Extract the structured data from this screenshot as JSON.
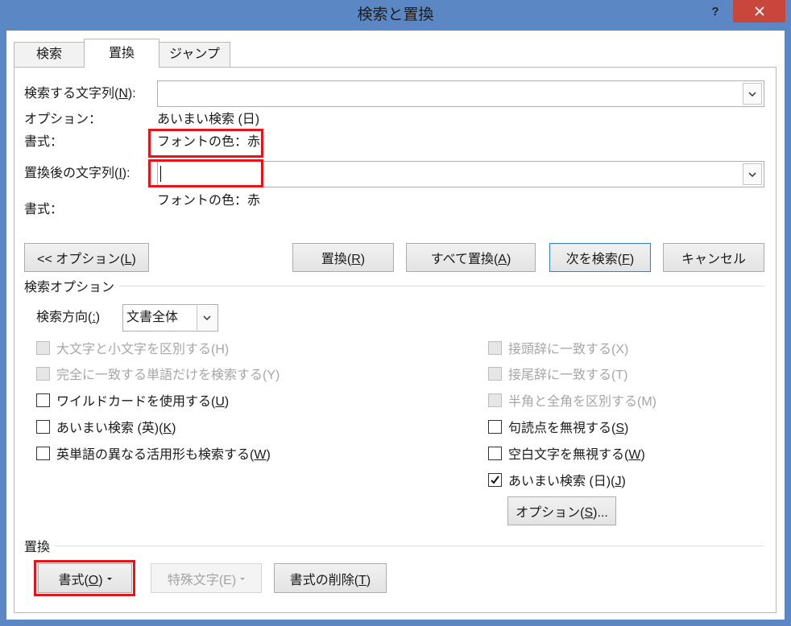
{
  "window": {
    "title": "検索と置換",
    "help_label": "?",
    "close_icon": "close-icon"
  },
  "colors": {
    "titlebar": "#5b88c4",
    "close_button": "#c9463d",
    "highlight": "#e4141b",
    "default_button_border": "#3c7fb1"
  },
  "tabs": [
    {
      "label": "検索",
      "selected": false
    },
    {
      "label": "置換",
      "selected": true
    },
    {
      "label": "ジャンプ",
      "selected": false
    }
  ],
  "find": {
    "label": "検索する文字列(N):",
    "mnemonic": "N",
    "value": "",
    "dropdown_icon": "chevron-down-icon",
    "options_label": "オプション：",
    "options_value": "あいまい検索 (日)",
    "format_label": "書式：",
    "format_value": "フォントの色：赤"
  },
  "replace": {
    "label": "置換後の文字列(I):",
    "mnemonic": "I",
    "value": "",
    "dropdown_icon": "chevron-down-icon",
    "format_label": "書式：",
    "format_value": "フォントの色：赤"
  },
  "buttons": {
    "less_options": {
      "label": "<< オプション(L)",
      "mnemonic": "L"
    },
    "replace": {
      "label": "置換(R)",
      "mnemonic": "R"
    },
    "replace_all": {
      "label": "すべて置換(A)",
      "mnemonic": "A"
    },
    "find_next": {
      "label": "次を検索(F)",
      "mnemonic": "F",
      "default": true
    },
    "cancel": {
      "label": "キャンセル"
    }
  },
  "search_options": {
    "heading": "検索オプション",
    "direction_label": "検索方向(:)",
    "direction_mnemonic": ":",
    "direction_value": "文書全体",
    "left": [
      {
        "label": "大文字と小文字を区別する(H)",
        "checked": false,
        "disabled": true
      },
      {
        "label": "完全に一致する単語だけを検索する(Y)",
        "checked": false,
        "disabled": true
      },
      {
        "label": "ワイルドカードを使用する(U)",
        "mnemonic": "U",
        "checked": false,
        "disabled": false
      },
      {
        "label": "あいまい検索 (英)(K)",
        "mnemonic": "K",
        "checked": false,
        "disabled": false
      },
      {
        "label": "英単語の異なる活用形も検索する(W)",
        "mnemonic": "W",
        "checked": false,
        "disabled": false
      }
    ],
    "right": [
      {
        "label": "接頭辞に一致する(X)",
        "checked": false,
        "disabled": true
      },
      {
        "label": "接尾辞に一致する(T)",
        "checked": false,
        "disabled": true
      },
      {
        "label": "半角と全角を区別する(M)",
        "checked": false,
        "disabled": true
      },
      {
        "label": "句読点を無視する(S)",
        "mnemonic": "S",
        "checked": false,
        "disabled": false
      },
      {
        "label": "空白文字を無視する(W)",
        "mnemonic": "W",
        "checked": false,
        "disabled": false
      },
      {
        "label": "あいまい検索 (日)(J)",
        "mnemonic": "J",
        "checked": true,
        "disabled": false
      }
    ],
    "fuzzy_options_button": {
      "label": "オプション(S)...",
      "mnemonic": "S"
    }
  },
  "replace_section": {
    "heading": "置換",
    "format_button": {
      "label": "書式(O)",
      "mnemonic": "O"
    },
    "special_button": {
      "label": "特殊文字(E)",
      "disabled": true
    },
    "clear_format_button": {
      "label": "書式の削除(T)",
      "mnemonic": "T"
    }
  }
}
